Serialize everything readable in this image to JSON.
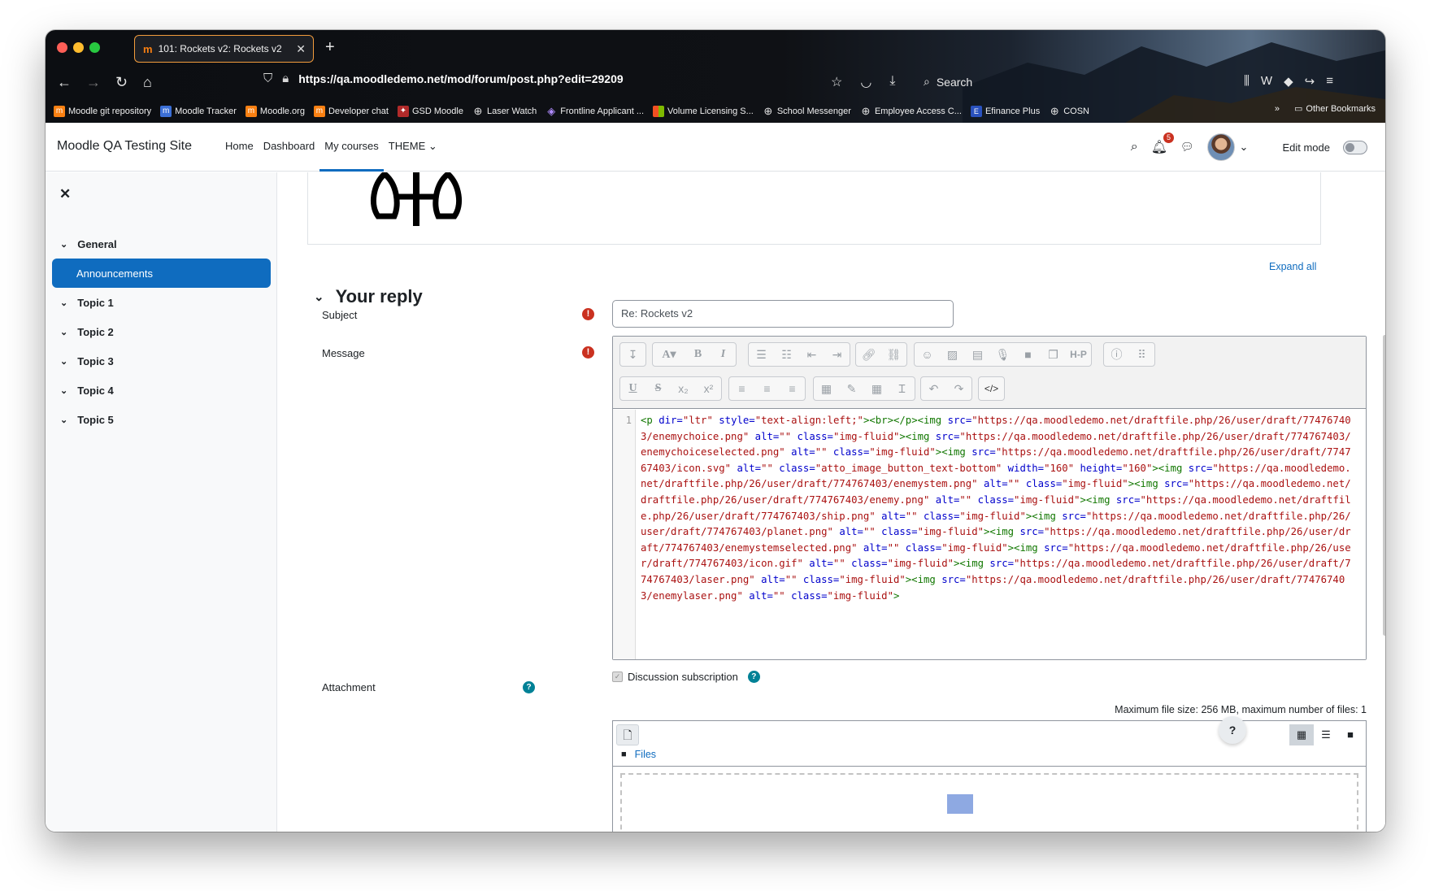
{
  "browser": {
    "tab_title": "101: Rockets v2: Rockets v2",
    "tab_favicon": "m",
    "new_tab": "+",
    "url": "https://qa.moodledemo.net/mod/forum/post.php?edit=29209",
    "search_label": "Search",
    "bookmarks": [
      {
        "label": "Moodle git repository",
        "icon": "moodle-icon"
      },
      {
        "label": "Moodle Tracker",
        "icon": "tracker-icon"
      },
      {
        "label": "Moodle.org",
        "icon": "moodle-icon"
      },
      {
        "label": "Developer chat",
        "icon": "moodle-icon"
      },
      {
        "label": "GSD Moodle",
        "icon": "gsd-icon"
      },
      {
        "label": "Laser Watch",
        "icon": "globe-icon"
      },
      {
        "label": "Frontline Applicant ...",
        "icon": "frontline-icon"
      },
      {
        "label": "Volume Licensing S...",
        "icon": "microsoft-icon"
      },
      {
        "label": "School Messenger",
        "icon": "globe-icon"
      },
      {
        "label": "Employee Access C...",
        "icon": "globe-icon"
      },
      {
        "label": "Efinance Plus",
        "icon": "efinance-icon"
      },
      {
        "label": "COSN",
        "icon": "globe-icon"
      }
    ],
    "other_bookmarks": "Other Bookmarks"
  },
  "moodle_nav": {
    "site_name": "Moodle QA Testing Site",
    "items": [
      {
        "label": "Home"
      },
      {
        "label": "Dashboard"
      },
      {
        "label": "My courses"
      },
      {
        "label": "THEME"
      }
    ],
    "notifications_count": "5",
    "edit_mode_label": "Edit mode"
  },
  "drawer": {
    "sections": [
      {
        "label": "General"
      },
      {
        "label": "Announcements"
      },
      {
        "label": "Topic 1"
      },
      {
        "label": "Topic 2"
      },
      {
        "label": "Topic 3"
      },
      {
        "label": "Topic 4"
      },
      {
        "label": "Topic 5"
      }
    ]
  },
  "form": {
    "expand_all": "Expand all",
    "heading": "Your reply",
    "subject_label": "Subject",
    "subject_value": "Re: Rockets v2",
    "message_label": "Message",
    "line_number": "1",
    "discussion_subscription": "Discussion subscription",
    "attachment_label": "Attachment",
    "max_file_size": "Maximum file size: 256 MB, maximum number of files: 1",
    "files_label": "Files",
    "help_button": "?"
  },
  "code_tokens": [
    {
      "t": "tg",
      "v": "<p "
    },
    {
      "t": "at",
      "v": "dir="
    },
    {
      "t": "st",
      "v": "\"ltr\""
    },
    {
      "t": "at",
      "v": " style="
    },
    {
      "t": "st",
      "v": "\"text-align:left;\""
    },
    {
      "t": "tg",
      "v": "><br></p><img "
    },
    {
      "t": "at",
      "v": "src="
    },
    {
      "t": "st",
      "v": "\"https://qa.moodledemo.net/draftfile.php/26/user/draft/774767403/enemychoice.png\""
    },
    {
      "t": "at",
      "v": " alt="
    },
    {
      "t": "st",
      "v": "\"\""
    },
    {
      "t": "at",
      "v": " class="
    },
    {
      "t": "st",
      "v": "\"img-fluid\""
    },
    {
      "t": "tg",
      "v": "><img "
    },
    {
      "t": "at",
      "v": "src="
    },
    {
      "t": "st",
      "v": "\"https://qa.moodledemo.net/draftfile.php/26/user/draft/774767403/enemychoiceselected.png\""
    },
    {
      "t": "at",
      "v": " alt="
    },
    {
      "t": "st",
      "v": "\"\""
    },
    {
      "t": "at",
      "v": " class="
    },
    {
      "t": "st",
      "v": "\"img-fluid\""
    },
    {
      "t": "tg",
      "v": "><img "
    },
    {
      "t": "at",
      "v": "src="
    },
    {
      "t": "st",
      "v": "\"https://qa.moodledemo.net/draftfile.php/26/user/draft/774767403/icon.svg\""
    },
    {
      "t": "at",
      "v": " alt="
    },
    {
      "t": "st",
      "v": "\"\""
    },
    {
      "t": "at",
      "v": " class="
    },
    {
      "t": "st",
      "v": "\"atto_image_button_text-bottom\""
    },
    {
      "t": "at",
      "v": " width="
    },
    {
      "t": "st",
      "v": "\"160\""
    },
    {
      "t": "at",
      "v": " height="
    },
    {
      "t": "st",
      "v": "\"160\""
    },
    {
      "t": "tg",
      "v": "><img "
    },
    {
      "t": "at",
      "v": "src="
    },
    {
      "t": "st",
      "v": "\"https://qa.moodledemo.net/draftfile.php/26/user/draft/774767403/enemystem.png\""
    },
    {
      "t": "at",
      "v": " alt="
    },
    {
      "t": "st",
      "v": "\"\""
    },
    {
      "t": "at",
      "v": " class="
    },
    {
      "t": "st",
      "v": "\"img-fluid\""
    },
    {
      "t": "tg",
      "v": "><img "
    },
    {
      "t": "at",
      "v": "src="
    },
    {
      "t": "st",
      "v": "\"https://qa.moodledemo.net/draftfile.php/26/user/draft/774767403/enemy.png\""
    },
    {
      "t": "at",
      "v": " alt="
    },
    {
      "t": "st",
      "v": "\"\""
    },
    {
      "t": "at",
      "v": " class="
    },
    {
      "t": "st",
      "v": "\"img-fluid\""
    },
    {
      "t": "tg",
      "v": "><img "
    },
    {
      "t": "at",
      "v": "src="
    },
    {
      "t": "st",
      "v": "\"https://qa.moodledemo.net/draftfile.php/26/user/draft/774767403/ship.png\""
    },
    {
      "t": "at",
      "v": " alt="
    },
    {
      "t": "st",
      "v": "\"\""
    },
    {
      "t": "at",
      "v": " class="
    },
    {
      "t": "st",
      "v": "\"img-fluid\""
    },
    {
      "t": "tg",
      "v": "><img "
    },
    {
      "t": "at",
      "v": "src="
    },
    {
      "t": "st",
      "v": "\"https://qa.moodledemo.net/draftfile.php/26/user/draft/774767403/planet.png\""
    },
    {
      "t": "at",
      "v": " alt="
    },
    {
      "t": "st",
      "v": "\"\""
    },
    {
      "t": "at",
      "v": " class="
    },
    {
      "t": "st",
      "v": "\"img-fluid\""
    },
    {
      "t": "tg",
      "v": "><img "
    },
    {
      "t": "at",
      "v": "src="
    },
    {
      "t": "st",
      "v": "\"https://qa.moodledemo.net/draftfile.php/26/user/draft/774767403/enemystemselected.png\""
    },
    {
      "t": "at",
      "v": " alt="
    },
    {
      "t": "st",
      "v": "\"\""
    },
    {
      "t": "at",
      "v": " class="
    },
    {
      "t": "st",
      "v": "\"img-fluid\""
    },
    {
      "t": "tg",
      "v": "><img "
    },
    {
      "t": "at",
      "v": "src="
    },
    {
      "t": "st",
      "v": "\"https://qa.moodledemo.net/draftfile.php/26/user/draft/774767403/icon.gif\""
    },
    {
      "t": "at",
      "v": " alt="
    },
    {
      "t": "st",
      "v": "\"\""
    },
    {
      "t": "at",
      "v": " class="
    },
    {
      "t": "st",
      "v": "\"img-fluid\""
    },
    {
      "t": "tg",
      "v": "><img "
    },
    {
      "t": "at",
      "v": "src="
    },
    {
      "t": "st",
      "v": "\"https://qa.moodledemo.net/draftfile.php/26/user/draft/774767403/laser.png\""
    },
    {
      "t": "at",
      "v": " alt="
    },
    {
      "t": "st",
      "v": "\"\""
    },
    {
      "t": "at",
      "v": " class="
    },
    {
      "t": "st",
      "v": "\"img-fluid\""
    },
    {
      "t": "tg",
      "v": "><img "
    },
    {
      "t": "at",
      "v": "src="
    },
    {
      "t": "st",
      "v": "\"https://qa.moodledemo.net/draftfile.php/26/user/draft/774767403/enemylaser.png\""
    },
    {
      "t": "at",
      "v": " alt="
    },
    {
      "t": "st",
      "v": "\"\""
    },
    {
      "t": "at",
      "v": " class="
    },
    {
      "t": "st",
      "v": "\"img-fluid\""
    },
    {
      "t": "tg",
      "v": ">"
    }
  ],
  "colors": {
    "primary": "#0f6cbf",
    "required": "#ca3120",
    "help": "#008196"
  }
}
